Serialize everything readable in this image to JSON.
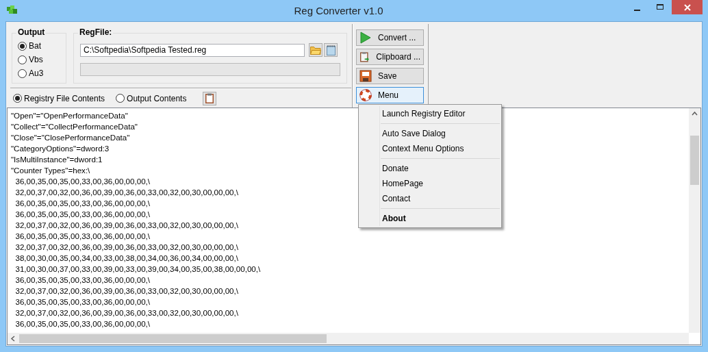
{
  "window": {
    "title": "Reg Converter v1.0"
  },
  "output": {
    "title": "Output",
    "options": [
      {
        "label": "Bat",
        "selected": true
      },
      {
        "label": "Vbs",
        "selected": false
      },
      {
        "label": "Au3",
        "selected": false
      }
    ]
  },
  "regfile": {
    "title": "RegFile:",
    "value": "C:\\Softpedia\\Softpedia Tested.reg",
    "progress": {
      "level": 0
    }
  },
  "view_options": [
    {
      "label": "Registry File Contents",
      "selected": true
    },
    {
      "label": "Output Contents",
      "selected": false
    }
  ],
  "buttons": [
    {
      "label": "Convert ...",
      "kind": "convert",
      "highlighted": false
    },
    {
      "label": "Clipboard ...",
      "kind": "clipboard",
      "highlighted": false
    },
    {
      "label": "Save",
      "kind": "save",
      "highlighted": false
    },
    {
      "label": "Menu",
      "kind": "menu",
      "highlighted": true
    }
  ],
  "menu": {
    "groups": [
      [
        {
          "label": "Launch Registry Editor",
          "default": false
        }
      ],
      [
        {
          "label": "Auto Save Dialog",
          "default": false
        },
        {
          "label": "Context Menu Options",
          "default": false
        }
      ],
      [
        {
          "label": "Donate",
          "default": false
        },
        {
          "label": "HomePage",
          "default": false
        },
        {
          "label": "Contact",
          "default": false
        }
      ],
      [
        {
          "label": "About",
          "default": true
        }
      ]
    ]
  },
  "text_lines": [
    "\"Open\"=\"OpenPerformanceData\"",
    "\"Collect\"=\"CollectPerformanceData\"",
    "\"Close\"=\"ClosePerformanceData\"",
    "\"CategoryOptions\"=dword:3",
    "\"IsMultiInstance\"=dword:1",
    "\"Counter Types\"=hex:\\",
    "  36,00,35,00,35,00,33,00,36,00,00,00,\\",
    "  32,00,37,00,32,00,36,00,39,00,36,00,33,00,32,00,30,00,00,00,\\",
    "  36,00,35,00,35,00,33,00,36,00,00,00,\\",
    "  36,00,35,00,35,00,33,00,36,00,00,00,\\",
    "  32,00,37,00,32,00,36,00,39,00,36,00,33,00,32,00,30,00,00,00,\\",
    "  36,00,35,00,35,00,33,00,36,00,00,00,\\",
    "  32,00,37,00,32,00,36,00,39,00,36,00,33,00,32,00,30,00,00,00,\\",
    "  38,00,30,00,35,00,34,00,33,00,38,00,34,00,36,00,34,00,00,00,\\",
    "  31,00,30,00,37,00,33,00,39,00,33,00,39,00,34,00,35,00,38,00,00,00,\\",
    "  36,00,35,00,35,00,33,00,36,00,00,00,\\",
    "  32,00,37,00,32,00,36,00,39,00,36,00,33,00,32,00,30,00,00,00,\\",
    "  36,00,35,00,35,00,33,00,36,00,00,00,\\",
    "  32,00,37,00,32,00,36,00,39,00,36,00,33,00,32,00,30,00,00,00,\\",
    "  36,00,35,00,35,00,33,00,36,00,00,00,\\"
  ]
}
